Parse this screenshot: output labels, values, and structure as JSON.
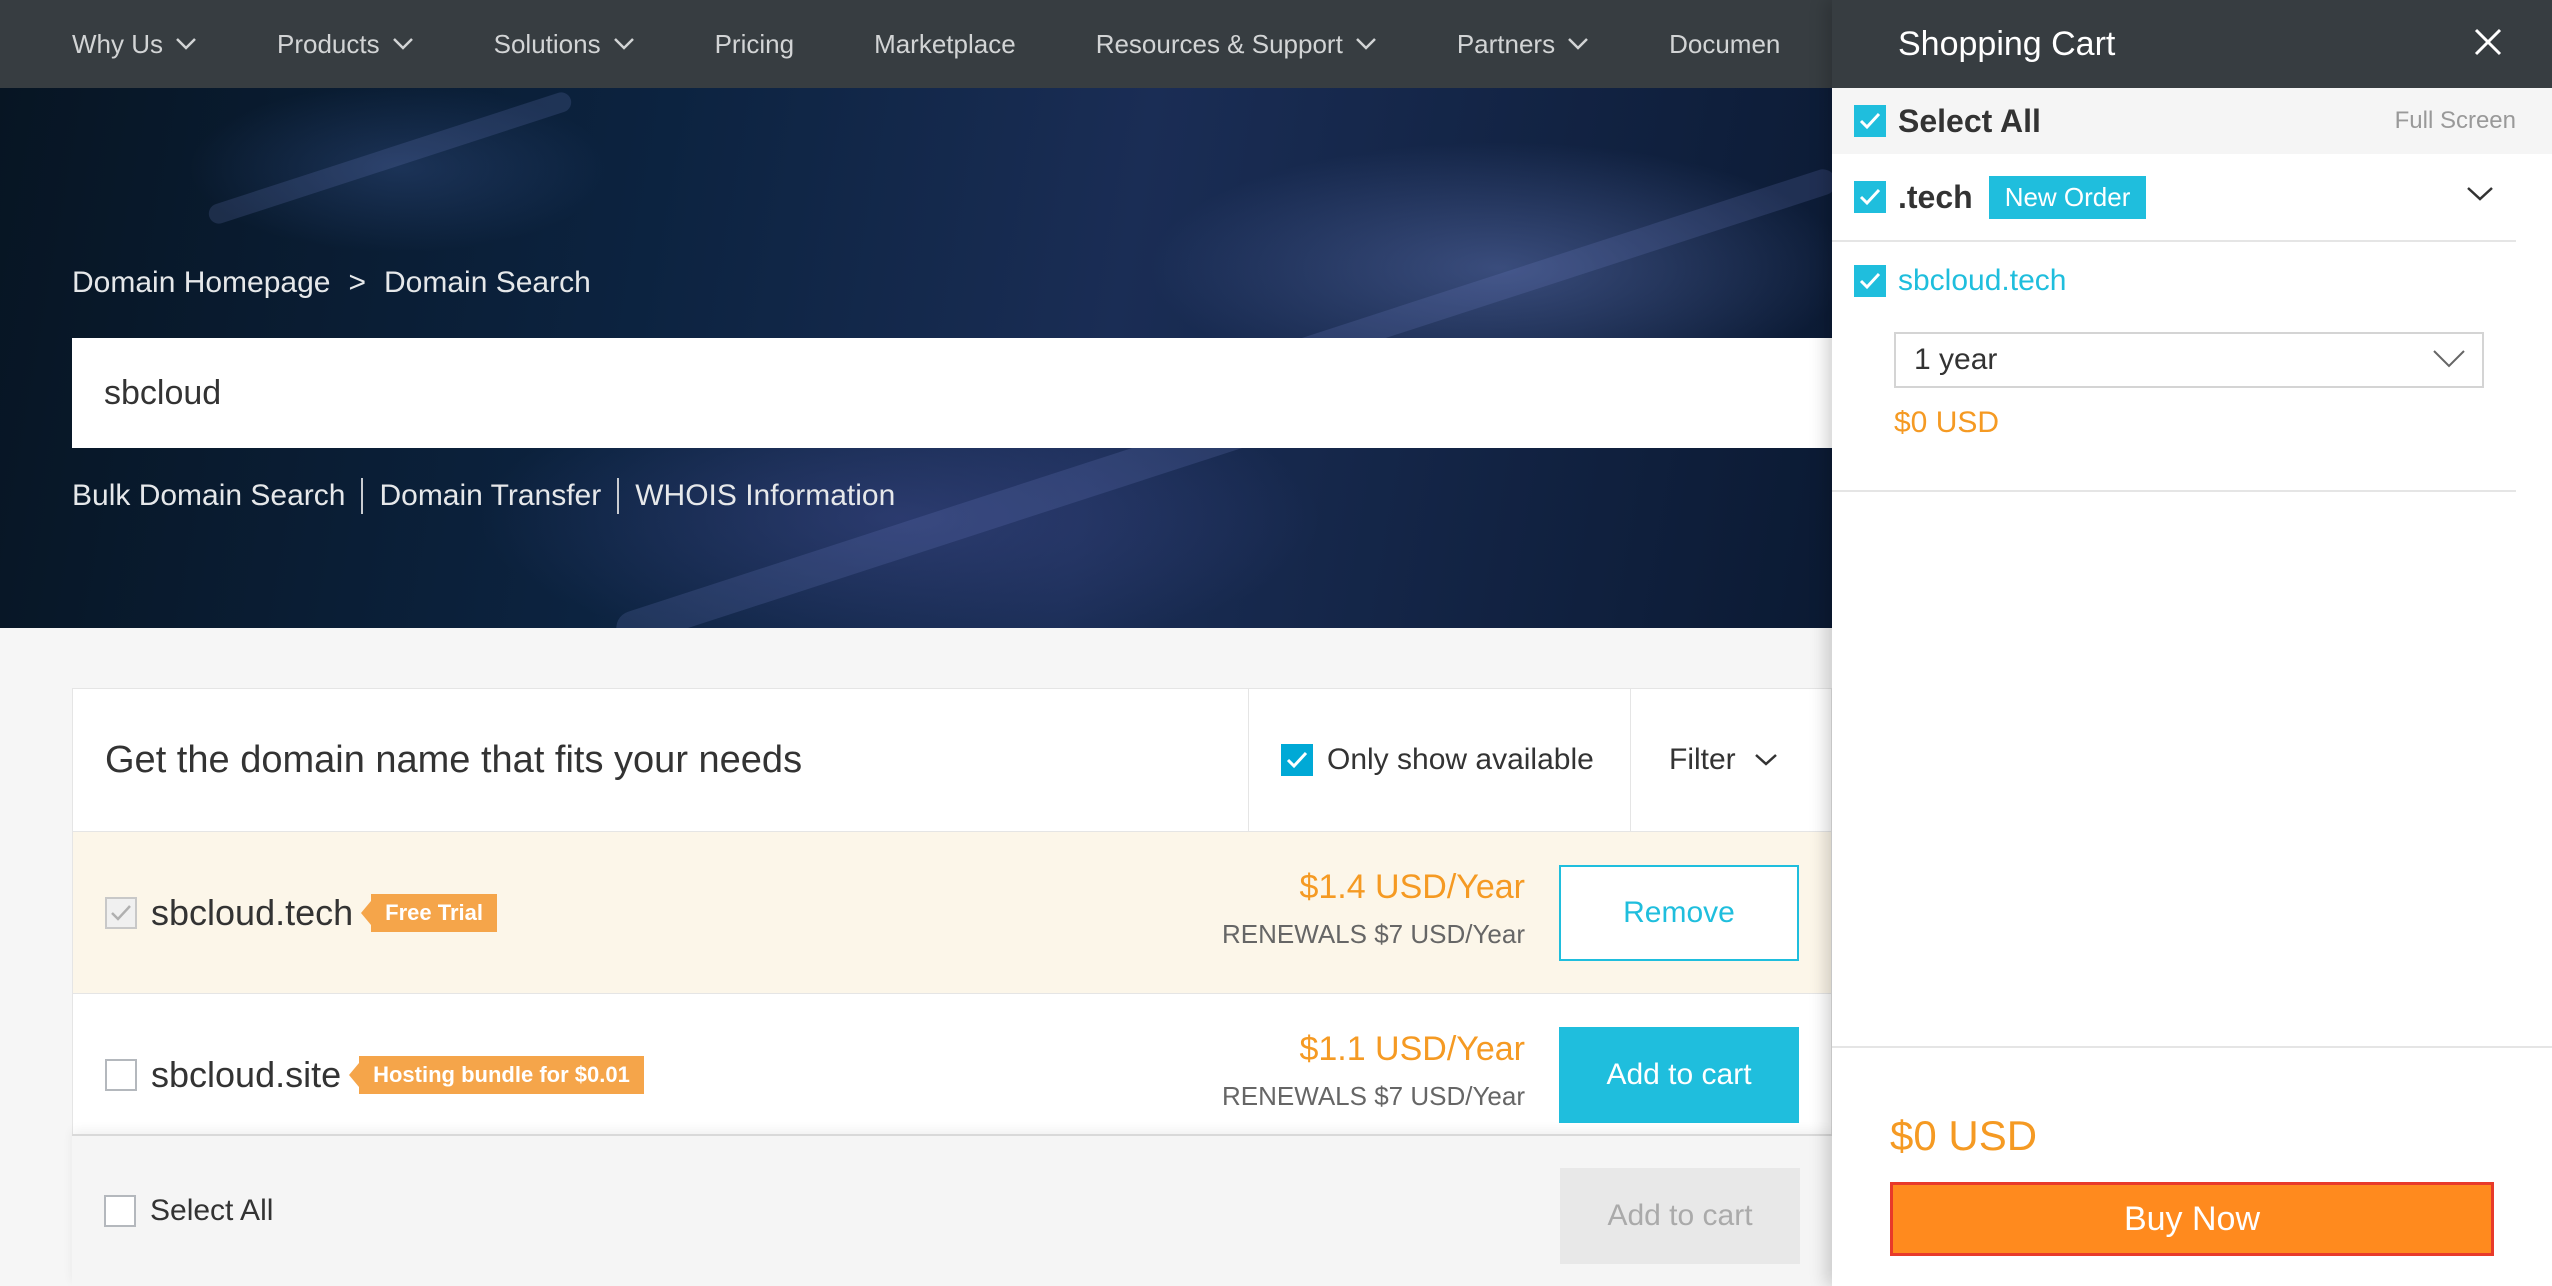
{
  "nav": {
    "items": [
      {
        "label": "Why Us",
        "has_dropdown": true
      },
      {
        "label": "Products",
        "has_dropdown": true
      },
      {
        "label": "Solutions",
        "has_dropdown": true
      },
      {
        "label": "Pricing",
        "has_dropdown": false
      },
      {
        "label": "Marketplace",
        "has_dropdown": false
      },
      {
        "label": "Resources & Support",
        "has_dropdown": true
      },
      {
        "label": "Partners",
        "has_dropdown": true
      },
      {
        "label": "Documen",
        "has_dropdown": false
      }
    ]
  },
  "hero": {
    "breadcrumb": {
      "home": "Domain Homepage",
      "separator": ">",
      "current": "Domain Search"
    },
    "search": {
      "value": "sbcloud"
    },
    "links": [
      "Bulk Domain Search",
      "Domain Transfer",
      "WHOIS Information"
    ]
  },
  "results": {
    "title": "Get the domain name that fits your needs",
    "only_available": {
      "label": "Only show available",
      "checked": true
    },
    "filter_label": "Filter",
    "rows": [
      {
        "domain": "sbcloud.tech",
        "tag": "Free Trial",
        "price": "$1.4 USD/Year",
        "renewal": "RENEWALS $7 USD/Year",
        "action": "Remove",
        "checked": true
      },
      {
        "domain": "sbcloud.site",
        "tag": "Hosting bundle for $0.01",
        "price": "$1.1 USD/Year",
        "renewal": "RENEWALS $7 USD/Year",
        "action": "Add to cart",
        "checked": false
      }
    ],
    "bulk": {
      "select_all": "Select All",
      "add_to_cart": "Add to cart"
    }
  },
  "cart": {
    "title": "Shopping Cart",
    "select_all": "Select All",
    "full_screen": "Full Screen",
    "group": {
      "name": ".tech",
      "badge": "New Order"
    },
    "item": {
      "domain": "sbcloud.tech",
      "period": "1 year",
      "amount": "$0 USD"
    },
    "total": "$0 USD",
    "buy_label": "Buy Now"
  },
  "colors": {
    "nav_bg": "#373d41",
    "accent": "#1fbedd",
    "price": "#f59a23",
    "buy": "#ff8a1e",
    "tag": "#f5a54a",
    "highlight_row": "#fcf6e9"
  }
}
